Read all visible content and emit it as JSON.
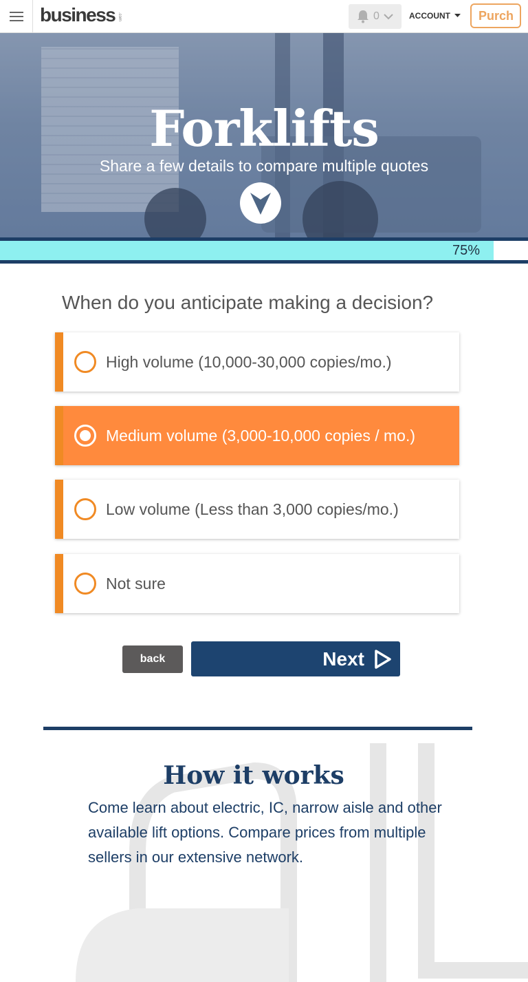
{
  "header": {
    "logo": "business",
    "logo_sup": ".com",
    "notification_count": "0",
    "account_label": "ACCOUNT",
    "purchase_label": "Purch"
  },
  "hero": {
    "title": "Forklifts",
    "subtitle": "Share a few details to compare multiple quotes"
  },
  "progress": {
    "percent": 75,
    "label": "75%"
  },
  "question": {
    "text": "When do you anticipate making a decision?",
    "options": [
      {
        "label": "High volume (10,000-30,000 copies/mo.)",
        "selected": false
      },
      {
        "label": "Medium volume (3,000-10,000 copies / mo.)",
        "selected": true
      },
      {
        "label": "Low volume (Less than 3,000 copies/mo.)",
        "selected": false
      },
      {
        "label": "Not sure",
        "selected": false
      }
    ]
  },
  "buttons": {
    "back": "back",
    "next": "Next"
  },
  "how_it_works": {
    "title": "How it works",
    "text": "Come learn about electric, IC, narrow aisle and other available lift options. Compare prices from multiple sellers in our extensive network."
  },
  "colors": {
    "accent_orange": "#f08a24",
    "selected_orange": "#ff8a3d",
    "navy": "#1d3e66",
    "progress_cyan": "#8ef0f0"
  }
}
